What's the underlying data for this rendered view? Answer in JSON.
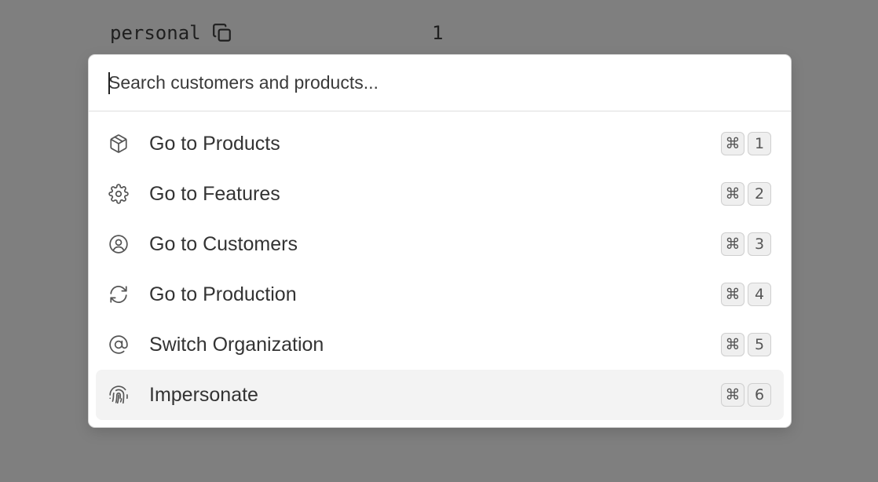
{
  "background": {
    "label": "personal",
    "value": "1",
    "copy_icon": "copy-icon"
  },
  "palette": {
    "search": {
      "placeholder": "Search customers and products...",
      "value": ""
    },
    "items": [
      {
        "label": "Go to Products",
        "icon": "box-icon",
        "modifier": "⌘",
        "key": "1"
      },
      {
        "label": "Go to Features",
        "icon": "gear-icon",
        "modifier": "⌘",
        "key": "2"
      },
      {
        "label": "Go to Customers",
        "icon": "user-circle-icon",
        "modifier": "⌘",
        "key": "3"
      },
      {
        "label": "Go to Production",
        "icon": "refresh-icon",
        "modifier": "⌘",
        "key": "4"
      },
      {
        "label": "Switch Organization",
        "icon": "at-sign-icon",
        "modifier": "⌘",
        "key": "5"
      },
      {
        "label": "Impersonate",
        "icon": "fingerprint-icon",
        "modifier": "⌘",
        "key": "6"
      }
    ],
    "active_index": 5
  },
  "colors": {
    "overlay": "#7f7f7f",
    "active_item_bg": "#f3f3f3",
    "text": "#333333"
  }
}
